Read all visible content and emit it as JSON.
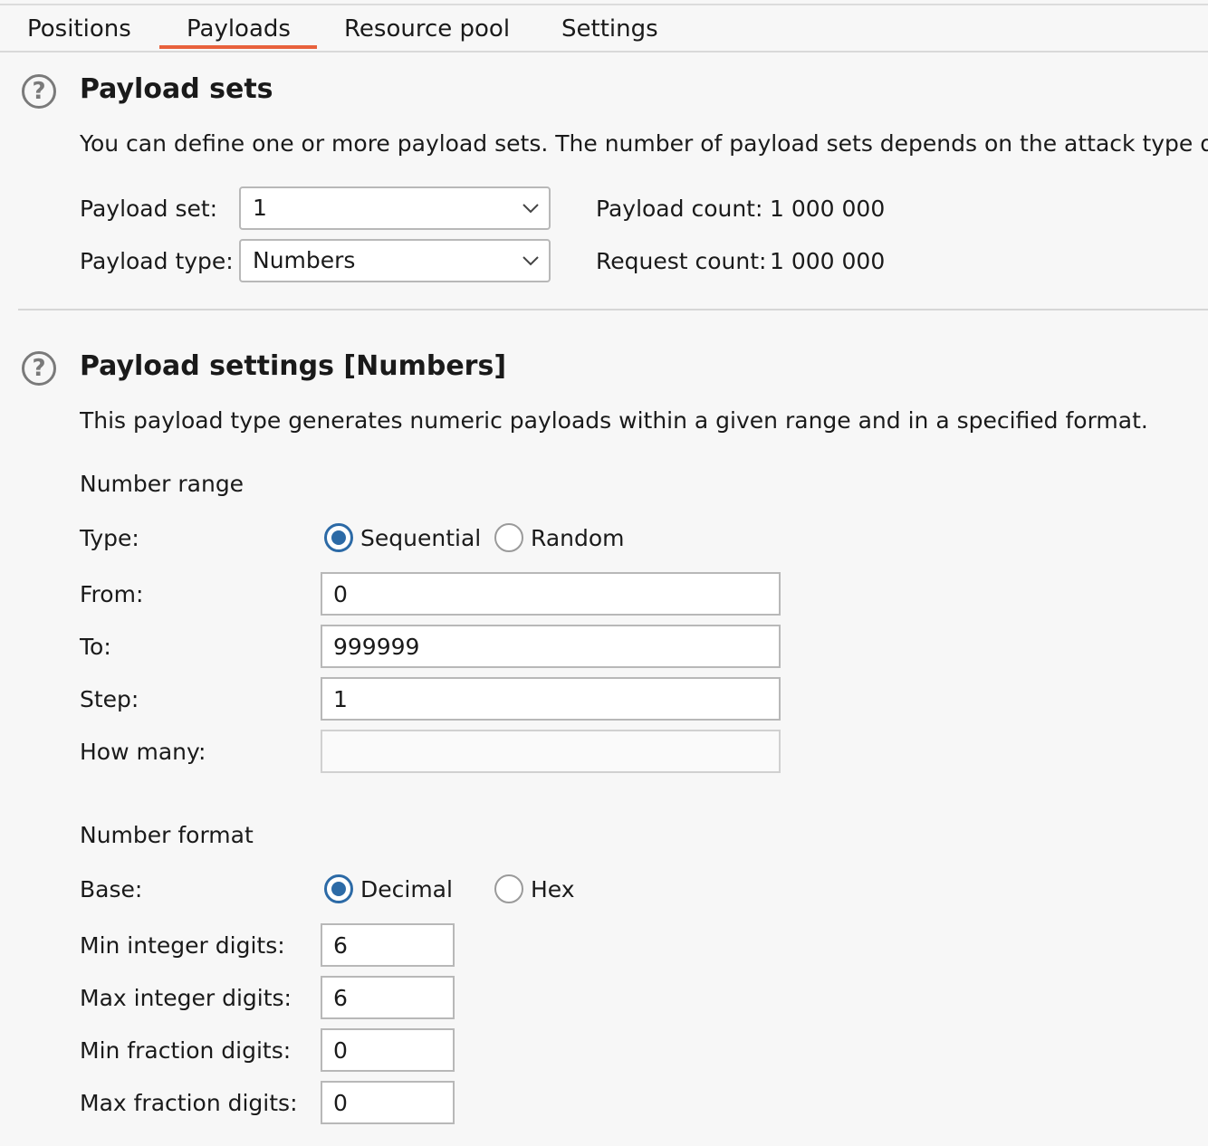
{
  "tabs": [
    {
      "label": "Positions"
    },
    {
      "label": "Payloads"
    },
    {
      "label": "Resource pool"
    },
    {
      "label": "Settings"
    }
  ],
  "active_tab": "Payloads",
  "payload_sets": {
    "title": "Payload sets",
    "description": "You can define one or more payload sets. The number of payload sets depends on the attack type def",
    "set_label": "Payload set:",
    "set_value": "1",
    "type_label": "Payload type:",
    "type_value": "Numbers",
    "payload_count_label": "Payload count:",
    "payload_count_value": "1 000 000",
    "request_count_label": "Request count:",
    "request_count_value": "1 000 000"
  },
  "payload_settings": {
    "title": "Payload settings [Numbers]",
    "description": "This payload type generates numeric payloads within a given range and in a specified format.",
    "number_range": {
      "heading": "Number range",
      "type_label": "Type:",
      "sequential_label": "Sequential",
      "random_label": "Random",
      "selected": "Sequential",
      "from_label": "From:",
      "from_value": "0",
      "to_label": "To:",
      "to_value": "999999",
      "step_label": "Step:",
      "step_value": "1",
      "how_many_label": "How many:",
      "how_many_value": ""
    },
    "number_format": {
      "heading": "Number format",
      "base_label": "Base:",
      "decimal_label": "Decimal",
      "hex_label": "Hex",
      "selected": "Decimal",
      "min_int_label": "Min integer digits:",
      "min_int_value": "6",
      "max_int_label": "Max integer digits:",
      "max_int_value": "6",
      "min_frac_label": "Min fraction digits:",
      "min_frac_value": "0",
      "max_frac_label": "Max fraction digits:",
      "max_frac_value": "0"
    }
  },
  "colors": {
    "accent_tab": "#e8613c",
    "radio_selected": "#2c6aa6"
  }
}
